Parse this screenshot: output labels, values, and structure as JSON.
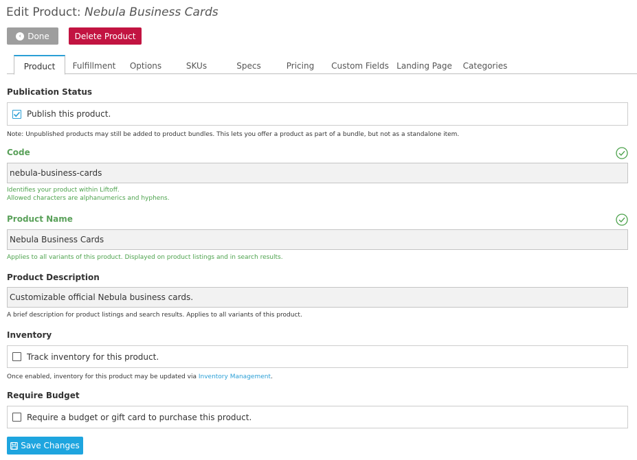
{
  "header": {
    "title_prefix": "Edit Product:",
    "title_name": "Nebula Business Cards"
  },
  "actions": {
    "done_label": "Done",
    "delete_label": "Delete Product",
    "done_icon": "chevron-left-circle-icon"
  },
  "tabs": [
    {
      "label": "Product",
      "active": true
    },
    {
      "label": "Fulfillment"
    },
    {
      "label": "Options"
    },
    {
      "label": "SKUs"
    },
    {
      "label": "Specs"
    },
    {
      "label": "Pricing"
    },
    {
      "label": "Custom Fields"
    },
    {
      "label": "Landing Page"
    },
    {
      "label": "Categories"
    }
  ],
  "publication": {
    "label": "Publication Status",
    "checkbox_label": "Publish this product.",
    "checked": true,
    "note": "Note: Unpublished products may still be added to product bundles. This lets you offer a product as part of a bundle, but not as a standalone item."
  },
  "code": {
    "label": "Code",
    "value": "nebula-business-cards",
    "help_line1": "Identifies your product within Liftoff.",
    "help_line2": "Allowed characters are alphanumerics and hyphens.",
    "valid": true
  },
  "product_name": {
    "label": "Product Name",
    "value": "Nebula Business Cards",
    "help": "Applies to all variants of this product. Displayed on product listings and in search results.",
    "valid": true
  },
  "description": {
    "label": "Product Description",
    "value": "Customizable official Nebula business cards.",
    "help": "A brief description for product listings and search results. Applies to all variants of this product."
  },
  "inventory": {
    "label": "Inventory",
    "checkbox_label": "Track inventory for this product.",
    "checked": false,
    "help_prefix": "Once enabled, inventory for this product may be updated via ",
    "help_link": "Inventory Management",
    "help_suffix": "."
  },
  "budget": {
    "label": "Require Budget",
    "checkbox_label": "Require a budget or gift card to purchase this product.",
    "checked": false
  },
  "footer": {
    "save_label": "Save Changes",
    "save_icon": "floppy-disk-icon"
  },
  "colors": {
    "accent": "#2a9fd6",
    "danger": "#c21441",
    "success": "#4ca24c",
    "neutral_button": "#9e9e9e"
  }
}
